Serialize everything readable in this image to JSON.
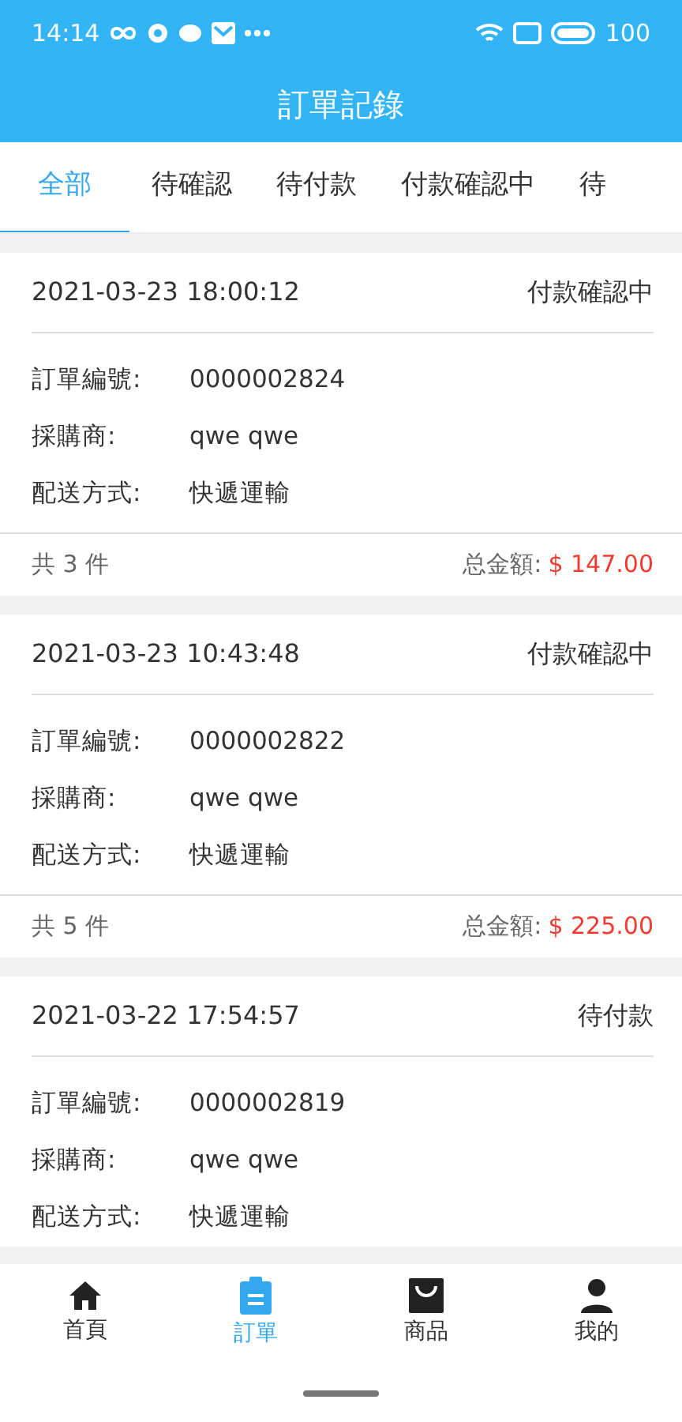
{
  "status_bar": {
    "time": "14:14",
    "battery": "100"
  },
  "title": "訂單記錄",
  "tabs": [
    {
      "label": "全部",
      "selected": true
    },
    {
      "label": "待確認",
      "selected": false
    },
    {
      "label": "待付款",
      "selected": false
    },
    {
      "label": "付款確認中",
      "selected": false
    },
    {
      "label": "待",
      "selected": false
    }
  ],
  "orders": [
    {
      "datetime": "2021-03-23 18:00:12",
      "status": "付款確認中",
      "fields": [
        {
          "label": "訂單編號:",
          "value": "0000002824"
        },
        {
          "label": "採購商:",
          "value": "qwe qwe"
        },
        {
          "label": "配送方式:",
          "value": "快遞運輸"
        }
      ],
      "count": "共 3 件",
      "total_label": "总金額:",
      "total": "$ 147.00"
    },
    {
      "datetime": "2021-03-23 10:43:48",
      "status": "付款確認中",
      "fields": [
        {
          "label": "訂單編號:",
          "value": "0000002822"
        },
        {
          "label": "採購商:",
          "value": "qwe qwe"
        },
        {
          "label": "配送方式:",
          "value": "快遞運輸"
        }
      ],
      "count": "共 5 件",
      "total_label": "总金額:",
      "total": "$ 225.00"
    },
    {
      "datetime": "2021-03-22 17:54:57",
      "status": "待付款",
      "fields": [
        {
          "label": "訂單編號:",
          "value": "0000002819"
        },
        {
          "label": "採購商:",
          "value": "qwe qwe"
        },
        {
          "label": "配送方式:",
          "value": "快遞運輸"
        }
      ]
    }
  ],
  "bottom_nav": [
    {
      "kind": "home",
      "label": "首頁",
      "selected": false
    },
    {
      "kind": "orders",
      "label": "訂單",
      "selected": true
    },
    {
      "kind": "products",
      "label": "商品",
      "selected": false
    },
    {
      "kind": "profile",
      "label": "我的",
      "selected": false
    }
  ]
}
